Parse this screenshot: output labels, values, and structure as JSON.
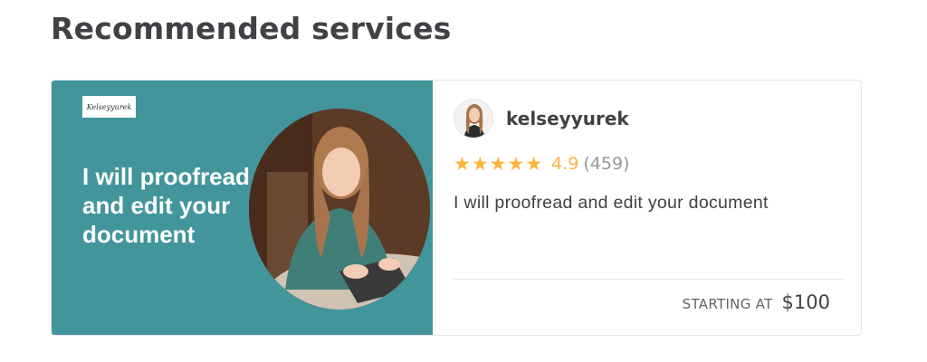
{
  "section": {
    "title": "Recommended services"
  },
  "gig": {
    "image_overlay_text": "I will proofread and edit your document",
    "logo_text": "Kelseyyurek",
    "title": "I will proofread and edit your document",
    "colors": {
      "image_bg": "#43959c",
      "star": "#ffb33e",
      "text": "#404145",
      "muted": "#95979d"
    }
  },
  "seller": {
    "username": "kelseyyurek"
  },
  "rating": {
    "score": "4.9",
    "count": "(459)",
    "stars": 5
  },
  "pricing": {
    "label": "STARTING AT",
    "price": "$100"
  },
  "icons": {
    "star": "star-icon",
    "avatar": "avatar"
  }
}
